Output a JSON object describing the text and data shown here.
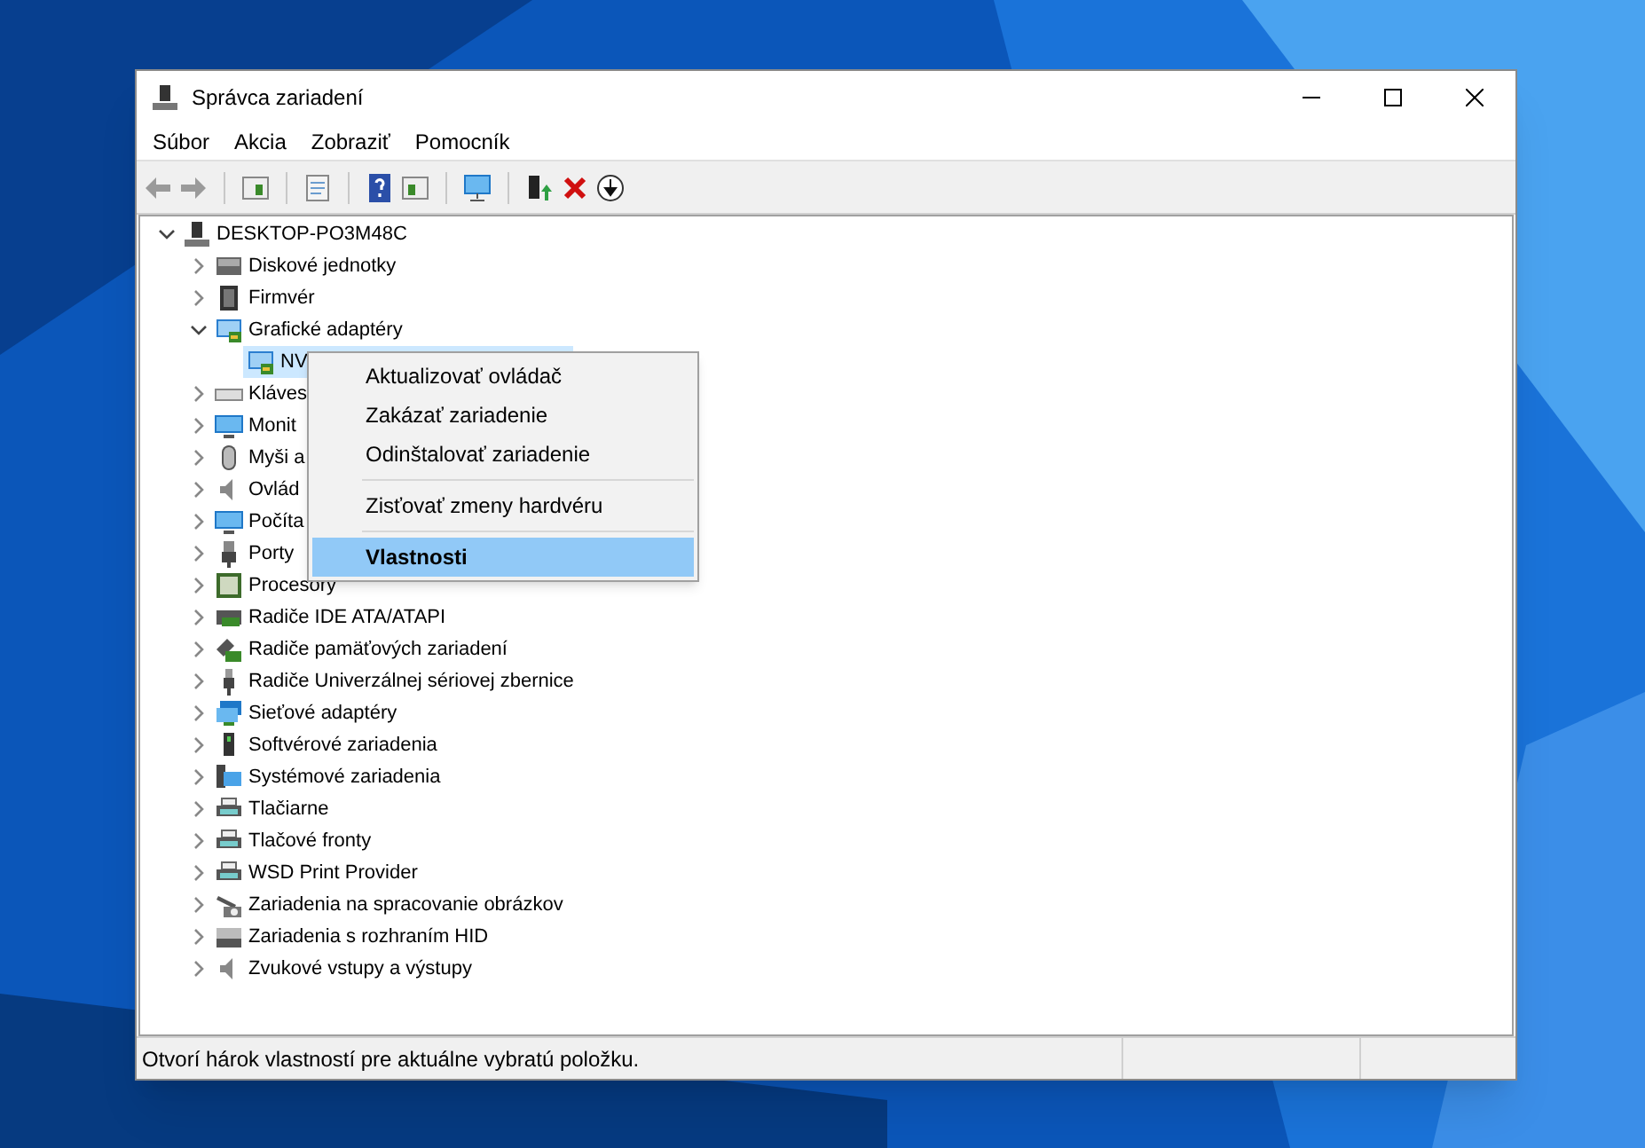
{
  "window": {
    "title": "Správca zariadení"
  },
  "menu_bar": [
    "Súbor",
    "Akcia",
    "Zobraziť",
    "Pomocník"
  ],
  "toolbar": [
    {
      "kind": "back"
    },
    {
      "kind": "forward"
    },
    {
      "kind": "sep"
    },
    {
      "kind": "tree"
    },
    {
      "kind": "sep"
    },
    {
      "kind": "properties"
    },
    {
      "kind": "sep"
    },
    {
      "kind": "help"
    },
    {
      "kind": "pane"
    },
    {
      "kind": "sep"
    },
    {
      "kind": "scan"
    },
    {
      "kind": "sep"
    },
    {
      "kind": "update"
    },
    {
      "kind": "remove"
    },
    {
      "kind": "down"
    }
  ],
  "tree": [
    {
      "label": "DESKTOP-PO3M48C",
      "kind": "computer",
      "expanded": true,
      "selected": false,
      "children": [
        {
          "label": "Diskové jednotky",
          "kind": "disk",
          "expanded": false,
          "selected": false
        },
        {
          "label": "Firmvér",
          "kind": "chip",
          "expanded": false,
          "selected": false
        },
        {
          "label": "Grafické adaptéry",
          "kind": "display",
          "expanded": true,
          "selected": false,
          "children": [
            {
              "label": "NV",
              "kind": "display",
              "selected": true
            }
          ]
        },
        {
          "label": "Kláves",
          "kind": "keyboard",
          "expanded": false,
          "selected": false
        },
        {
          "label": "Monit",
          "kind": "monitor",
          "expanded": false,
          "selected": false
        },
        {
          "label": "Myši a",
          "kind": "mouse",
          "expanded": false,
          "selected": false
        },
        {
          "label": "Ovlád",
          "kind": "sound",
          "expanded": false,
          "selected": false
        },
        {
          "label": "Počíta",
          "kind": "monitor",
          "expanded": false,
          "selected": false
        },
        {
          "label": "Porty",
          "kind": "port",
          "expanded": false,
          "selected": false
        },
        {
          "label": "Procesory",
          "kind": "cpu",
          "expanded": false,
          "selected": false
        },
        {
          "label": "Radiče IDE ATA/ATAPI",
          "kind": "ide",
          "expanded": false,
          "selected": false
        },
        {
          "label": "Radiče pamäťových zariadení",
          "kind": "storage",
          "expanded": false,
          "selected": false
        },
        {
          "label": "Radiče Univerzálnej sériovej zbernice",
          "kind": "usb",
          "expanded": false,
          "selected": false
        },
        {
          "label": "Sieťové adaptéry",
          "kind": "network",
          "expanded": false,
          "selected": false
        },
        {
          "label": "Softvérové zariadenia",
          "kind": "software",
          "expanded": false,
          "selected": false
        },
        {
          "label": "Systémové zariadenia",
          "kind": "system",
          "expanded": false,
          "selected": false
        },
        {
          "label": "Tlačiarne",
          "kind": "printer",
          "expanded": false,
          "selected": false
        },
        {
          "label": "Tlačové fronty",
          "kind": "printer",
          "expanded": false,
          "selected": false
        },
        {
          "label": "WSD Print Provider",
          "kind": "printer",
          "expanded": false,
          "selected": false
        },
        {
          "label": "Zariadenia na spracovanie obrázkov",
          "kind": "camera",
          "expanded": false,
          "selected": false
        },
        {
          "label": "Zariadenia s rozhraním HID",
          "kind": "hid",
          "expanded": false,
          "selected": false
        },
        {
          "label": "Zvukové vstupy a výstupy",
          "kind": "sound",
          "expanded": false,
          "selected": false
        }
      ]
    }
  ],
  "context_menu": [
    {
      "label": "Aktualizovať ovládač",
      "kind": "item",
      "selected": false
    },
    {
      "label": "Zakázať zariadenie",
      "kind": "item",
      "selected": false
    },
    {
      "label": "Odinštalovať zariadenie",
      "kind": "item",
      "selected": false
    },
    {
      "kind": "separator"
    },
    {
      "label": "Zisťovať zmeny hardvéru",
      "kind": "item",
      "selected": false
    },
    {
      "kind": "separator"
    },
    {
      "label": "Vlastnosti",
      "kind": "item",
      "selected": true,
      "bold": true
    }
  ],
  "status_bar": {
    "text": "Otvorí hárok vlastností pre aktuálne vybratú položku."
  }
}
